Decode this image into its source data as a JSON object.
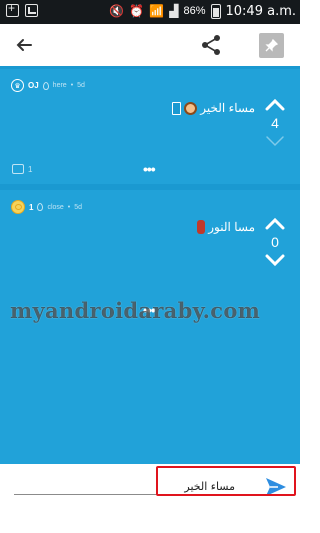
{
  "status_bar": {
    "battery": "86%",
    "time": "10:49 a.m."
  },
  "icons": {
    "back": "back-arrow-icon",
    "share": "share-icon",
    "pin": "pin-icon",
    "send": "send-icon"
  },
  "posts": [
    {
      "user": "OJ",
      "location": "here",
      "age": "5d",
      "text": "مساء الخير",
      "votes": "4",
      "comments": "1",
      "more": "•••"
    },
    {
      "user": "1",
      "location": "close",
      "age": "5d",
      "text": "مسا النور",
      "votes": "0",
      "more": "•••"
    }
  ],
  "watermark": "myandroidaraby.com",
  "composer": {
    "value": "مساء الخير"
  },
  "colors": {
    "feed_bg": "#1a99d1",
    "post_bg": "#21a2d9",
    "send_accent": "#2d8de0",
    "highlight": "#e0141d"
  }
}
